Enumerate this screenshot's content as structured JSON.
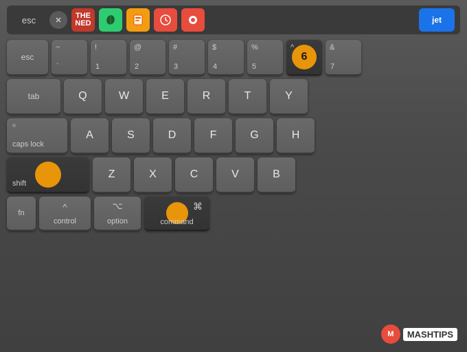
{
  "touchbar": {
    "esc": "esc",
    "jet_label": "jet"
  },
  "rows": {
    "number_row": {
      "keys": [
        {
          "label": "~\n`",
          "main": "`",
          "top": "~"
        },
        {
          "label": "!",
          "main": "1",
          "sub": "!"
        },
        {
          "label": "@",
          "main": "2",
          "sub": "@"
        },
        {
          "label": "#",
          "main": "3",
          "sub": "#"
        },
        {
          "label": "$",
          "main": "4",
          "sub": "$"
        },
        {
          "label": "%",
          "main": "5",
          "sub": "%"
        },
        {
          "label": "^",
          "main": "6",
          "sub": "^",
          "highlight": true
        },
        {
          "label": "&",
          "main": "7",
          "sub": "&"
        }
      ]
    },
    "qwerty_row": {
      "keys": [
        "Q",
        "W",
        "E",
        "R",
        "T",
        "Y"
      ]
    },
    "asdf_row": {
      "keys": [
        "A",
        "S",
        "D",
        "F",
        "G",
        "H"
      ]
    },
    "zxcv_row": {
      "keys": [
        "Z",
        "X",
        "C",
        "V",
        "B"
      ]
    },
    "bottom_row": {
      "fn": "fn",
      "control": "control",
      "control_symbol": "^",
      "option": "option",
      "option_symbol": "⌥",
      "command": "command",
      "command_symbol": "⌘"
    }
  },
  "branding": {
    "logo_text": "M",
    "name": "MASHTIPS"
  },
  "colors": {
    "orange": "#e8950a",
    "dark_key": "#3a3a3a",
    "normal_key": "#616161",
    "highlight_key": "#e8a020"
  }
}
